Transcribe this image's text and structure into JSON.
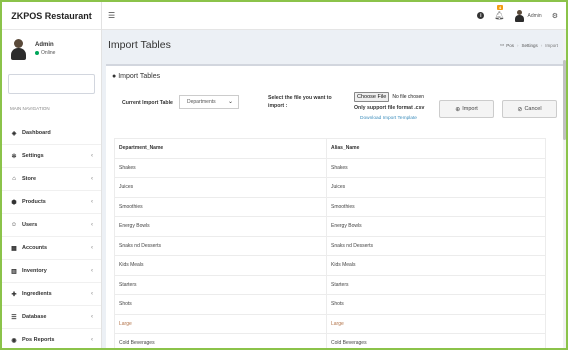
{
  "app": {
    "brand": "ZKPOS Restaurant"
  },
  "user": {
    "name": "Admin",
    "status": "Online"
  },
  "sidebar": {
    "header": "MAIN NAVIGATION",
    "items": [
      {
        "label": "Dashboard",
        "icon": "dashboard-icon",
        "glyph": "◈",
        "has_chevron": false
      },
      {
        "label": "Settings",
        "icon": "gear-icon",
        "glyph": "✲",
        "has_chevron": true
      },
      {
        "label": "Store",
        "icon": "store-icon",
        "glyph": "⌂",
        "has_chevron": true
      },
      {
        "label": "Products",
        "icon": "products-icon",
        "glyph": "⬢",
        "has_chevron": true
      },
      {
        "label": "Users",
        "icon": "users-icon",
        "glyph": "☺",
        "has_chevron": true
      },
      {
        "label": "Accounts",
        "icon": "calculator-icon",
        "glyph": "▦",
        "has_chevron": true
      },
      {
        "label": "Inventory",
        "icon": "inventory-icon",
        "glyph": "▥",
        "has_chevron": true
      },
      {
        "label": "Ingredients",
        "icon": "plus-icon",
        "glyph": "✚",
        "has_chevron": true
      },
      {
        "label": "Database",
        "icon": "database-icon",
        "glyph": "☰",
        "has_chevron": true
      },
      {
        "label": "Pos Reports",
        "icon": "reports-icon",
        "glyph": "◉",
        "has_chevron": true
      }
    ]
  },
  "topbar": {
    "notification_count": "4",
    "user_name": "Admin"
  },
  "page": {
    "title": "Import Tables",
    "breadcrumb": [
      "Pos",
      "Settings",
      "Import"
    ]
  },
  "box": {
    "title": "Import Tables",
    "current_table_label": "Current Import Table",
    "current_table_value": "Departments",
    "select_file_label": "Select the file you want to import :",
    "choose_file_label": "Choose File",
    "no_file_text": "No file chosen",
    "support_text": "Only support file format .csv",
    "download_link": "Download Import Template",
    "import_button": "Import",
    "cancel_button": "Cancel"
  },
  "table": {
    "headers": [
      "Department_Name",
      "Alias_Name"
    ],
    "rows": [
      [
        "Shakes",
        "Shakes"
      ],
      [
        "Juices",
        "Juices"
      ],
      [
        "Smoothies",
        "Smoothies"
      ],
      [
        "Energy Bowls",
        "Energy Bowls"
      ],
      [
        "Snaks nd Desserts",
        "Snaks nd Desserts"
      ],
      [
        "Kids Meals",
        "Kids Meals"
      ],
      [
        "Starters",
        "Starters"
      ],
      [
        "Shots",
        "Shots"
      ],
      [
        "Large",
        "Large"
      ],
      [
        "Cold Beverages",
        "Cold Beverages"
      ]
    ]
  },
  "colors": {
    "frame": "#8bc34a",
    "online": "#00a65a",
    "badge": "#f39c12",
    "link": "#3c8dbc"
  }
}
